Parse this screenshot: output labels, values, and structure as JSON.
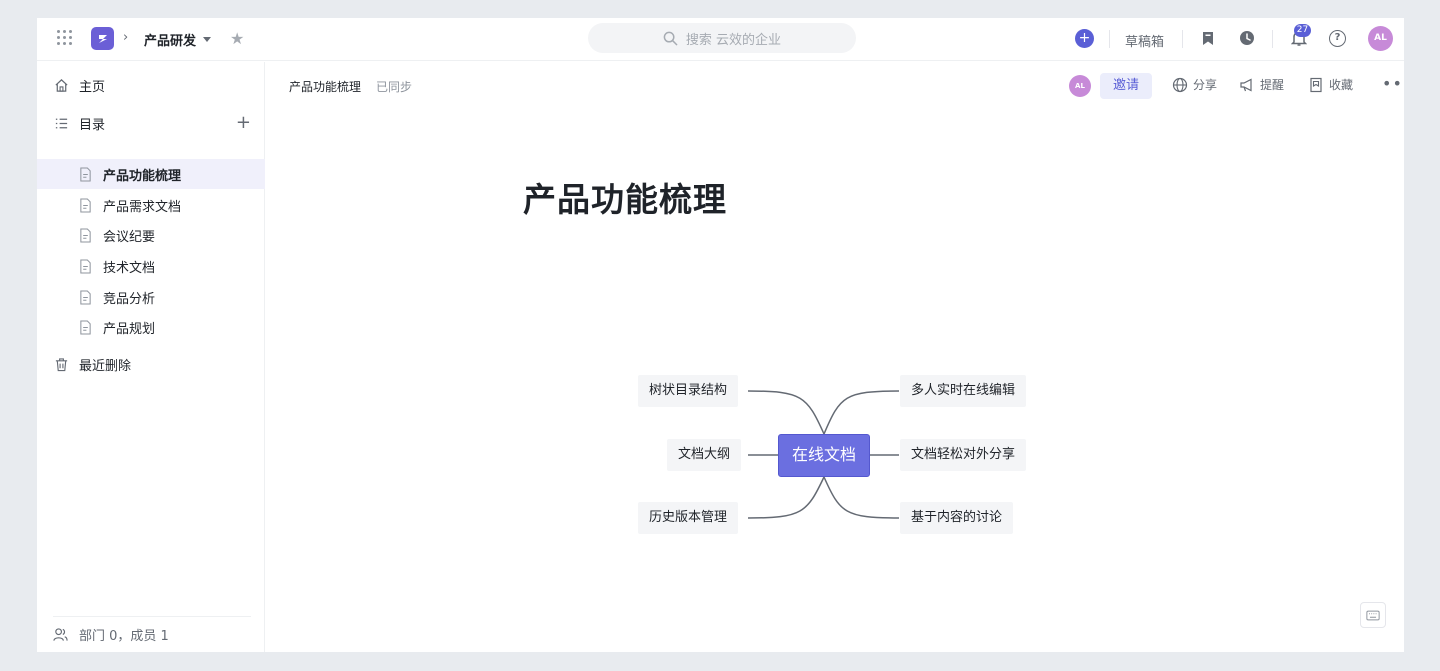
{
  "topbar": {
    "space_name": "产品研发",
    "search_placeholder": "搜索 云效的企业",
    "drafts_label": "草稿箱",
    "notification_count": "27",
    "avatar_initials": "AL"
  },
  "sidebar": {
    "home_label": "主页",
    "catalog_label": "目录",
    "docs": [
      {
        "label": "产品功能梳理",
        "active": true
      },
      {
        "label": "产品需求文档",
        "active": false
      },
      {
        "label": "会议纪要",
        "active": false
      },
      {
        "label": "技术文档",
        "active": false
      },
      {
        "label": "竞品分析",
        "active": false
      },
      {
        "label": "产品规划",
        "active": false
      }
    ],
    "trash_label": "最近删除",
    "footer_text": "部门 0，成员 1"
  },
  "doc_header": {
    "title": "产品功能梳理",
    "sync_status": "已同步",
    "avatar_initials": "AL",
    "invite_label": "邀请",
    "share_label": "分享",
    "remind_label": "提醒",
    "collect_label": "收藏"
  },
  "document": {
    "title": "产品功能梳理"
  },
  "mindmap": {
    "center": "在线文档",
    "left": [
      "树状目录结构",
      "文档大纲",
      "历史版本管理"
    ],
    "right": [
      "多人实时在线编辑",
      "文档轻松对外分享",
      "基于内容的讨论"
    ]
  },
  "colors": {
    "accent": "#5a5fd6",
    "center_node": "#6b6fe0",
    "node_bg": "#f4f5f7",
    "active_row": "#f0f0fb"
  }
}
